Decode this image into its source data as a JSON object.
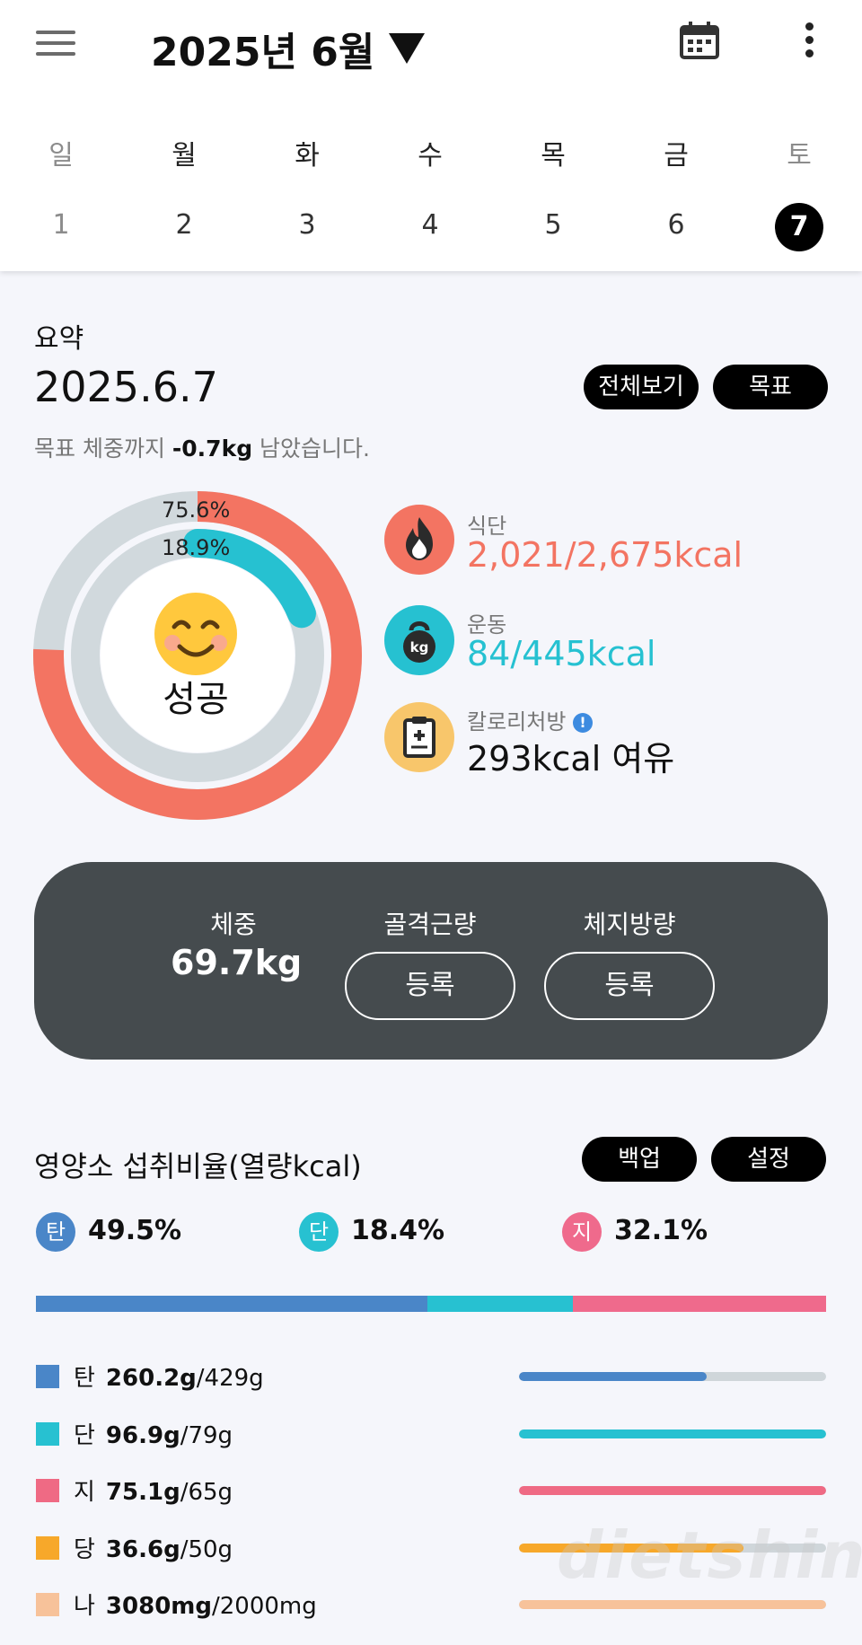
{
  "header": {
    "month_title": "2025년 6월",
    "weekdays": [
      "일",
      "월",
      "화",
      "수",
      "목",
      "금",
      "토"
    ],
    "days": [
      "1",
      "2",
      "3",
      "4",
      "5",
      "6",
      "7"
    ],
    "selected_day": "7"
  },
  "summary": {
    "label": "요약",
    "date": "2025.6.7",
    "view_all_label": "전체보기",
    "goal_label": "목표",
    "goal_message_prefix": "목표 체중까지 ",
    "goal_message_value": "-0.7kg",
    "goal_message_suffix": " 남았습니다.",
    "ring": {
      "outer_pct_label": "75.6%",
      "inner_pct_label": "18.9%",
      "outer_fraction": 0.756,
      "inner_fraction": 0.189,
      "status": "성공"
    },
    "diet": {
      "label": "식단",
      "value": "2,021/2,675kcal",
      "color": "#f37462"
    },
    "exercise": {
      "label": "운동",
      "value": "84/445kcal",
      "color": "#26c1d1"
    },
    "prescription": {
      "label": "칼로리처방",
      "value": "293kcal 여유",
      "color": "#f8c66b"
    }
  },
  "weight_card": {
    "weight_label": "체중",
    "weight_value": "69.7kg",
    "muscle_label": "골격근량",
    "fat_label": "체지방량",
    "register_label": "등록"
  },
  "nutrients": {
    "title": "영양소 섭취비율(열량kcal)",
    "backup_label": "백업",
    "settings_label": "설정",
    "ratios": [
      {
        "badge": "탄",
        "pct": "49.5%",
        "value": 49.5,
        "color": "#4a86c8"
      },
      {
        "badge": "단",
        "pct": "18.4%",
        "value": 18.4,
        "color": "#27c1d1"
      },
      {
        "badge": "지",
        "pct": "32.1%",
        "value": 32.1,
        "color": "#ef6a8c"
      }
    ],
    "rows": [
      {
        "name": "탄",
        "amount": "260.2g",
        "target": "/429g",
        "fraction": 0.61,
        "color": "#4a86c8"
      },
      {
        "name": "단",
        "amount": "96.9g",
        "target": "/79g",
        "fraction": 1.0,
        "color": "#27c1d1"
      },
      {
        "name": "지",
        "amount": "75.1g",
        "target": "/65g",
        "fraction": 1.0,
        "color": "#ef6a84"
      },
      {
        "name": "당",
        "amount": "36.6g",
        "target": "/50g",
        "fraction": 0.73,
        "color": "#f7a82a"
      },
      {
        "name": "나",
        "amount": "3080mg",
        "target": "/2000mg",
        "fraction": 1.0,
        "color": "#f7c29a"
      }
    ]
  },
  "watermark": "dietshin.com"
}
